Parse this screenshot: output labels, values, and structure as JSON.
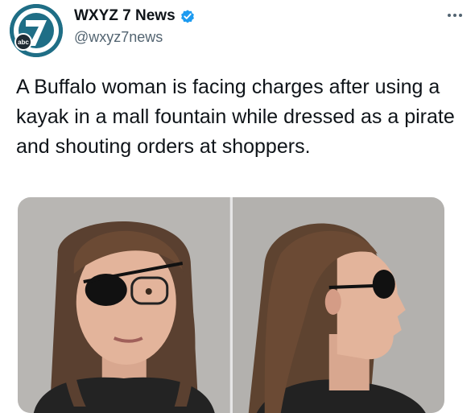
{
  "account": {
    "display_name": "WXYZ 7 News",
    "handle": "@wxyz7news",
    "verified": true,
    "avatar_icon": "wxyz-7-abc-logo",
    "avatar_logo_text": "abc"
  },
  "tweet": {
    "text": "A Buffalo woman is facing charges after using a kayak in a mall fountain while dressed as a pirate and shouting orders at shoppers."
  },
  "media": {
    "photos": [
      {
        "name": "mugshot-front"
      },
      {
        "name": "mugshot-profile"
      }
    ]
  },
  "colors": {
    "verified_badge": "#1d9bf0",
    "avatar_bg": "#1f6e86",
    "handle_text": "#536471"
  },
  "icons": {
    "more": "more-horizontal-icon",
    "verified": "verified-badge-icon"
  }
}
